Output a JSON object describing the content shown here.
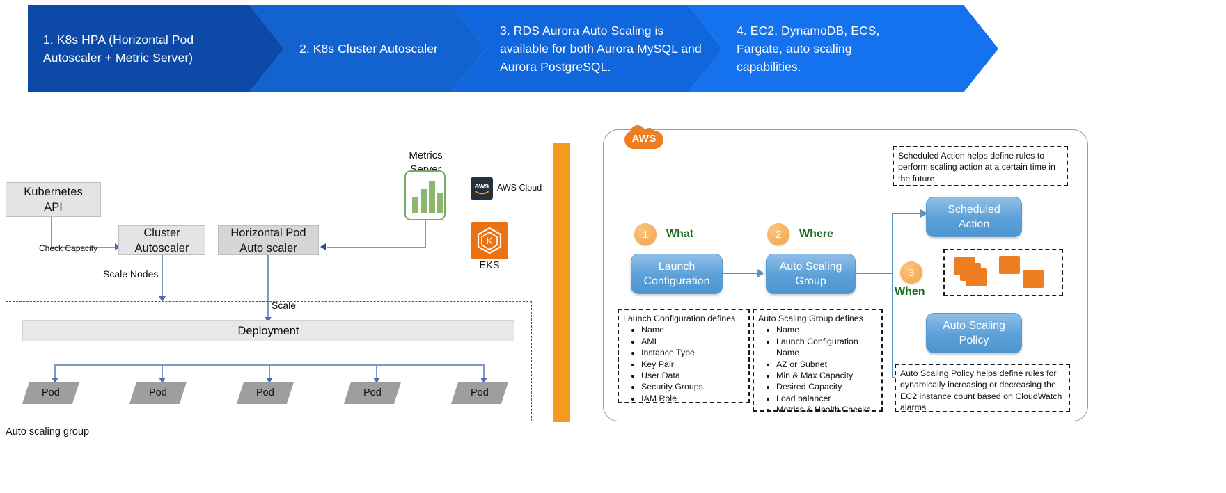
{
  "banner": {
    "steps": [
      {
        "label": "1. K8s HPA (Horizontal Pod Autoscaler + Metric Server)",
        "color": "#0d4aa7"
      },
      {
        "label": "2. K8s Cluster Autoscaler",
        "color": "#1262d0"
      },
      {
        "label": "3. RDS Aurora Auto Scaling is available for both Aurora MySQL and Aurora PostgreSQL.",
        "color": "#1066dd"
      },
      {
        "label": "4. EC2, DynamoDB, ECS, Fargate, auto scaling capabilities.",
        "color": "#1572ee"
      }
    ]
  },
  "k8s_diagram": {
    "kubernetes_api": "Kubernetes\nAPI",
    "kubernetes_api_line1": "Kubernetes",
    "kubernetes_api_line2": "API",
    "cluster_autoscaler_line1": "Cluster",
    "cluster_autoscaler_line2": "Autoscaler",
    "hpa_line1": "Horizontal Pod",
    "hpa_line2": "Auto scaler",
    "metrics_server_line1": "Metrics",
    "metrics_server_line2": "Server",
    "aws_cloud_icon_text": "aws",
    "aws_cloud_label": "AWS Cloud",
    "eks_label": "EKS",
    "edge_check_capacity": "Check Capacity",
    "edge_scale_nodes": "Scale Nodes",
    "edge_scale": "Scale",
    "deployment_label": "Deployment",
    "pods": [
      "Pod",
      "Pod",
      "Pod",
      "Pod",
      "Pod"
    ],
    "asg_caption": "Auto scaling group"
  },
  "aws_diagram": {
    "cloud_badge": "AWS",
    "steps": [
      {
        "num": "1",
        "word": "What"
      },
      {
        "num": "2",
        "word": "Where"
      },
      {
        "num": "3",
        "word": "When"
      }
    ],
    "launch_configuration_line1": "Launch",
    "launch_configuration_line2": "Configuration",
    "auto_scaling_group_line1": "Auto Scaling",
    "auto_scaling_group_line2": "Group",
    "scheduled_action_line1": "Scheduled",
    "scheduled_action_line2": "Action",
    "auto_scaling_policy_line1": "Auto Scaling",
    "auto_scaling_policy_line2": "Policy",
    "scheduled_action_note": "Scheduled Action helps define rules to perform scaling action at a certain time in the future",
    "auto_scaling_policy_note": "Auto Scaling Policy helps define rules for dynamically increasing or decreasing the EC2 instance count based on CloudWatch alarms",
    "launch_config_note_title": "Launch Configuration defines",
    "launch_config_note_items": [
      "Name",
      "AMI",
      "Instance Type",
      "Key Pair",
      "User Data",
      "Security Groups",
      "IAM Role"
    ],
    "asg_note_title": "Auto Scaling Group defines",
    "asg_note_items": [
      "Name",
      "Launch Configuration Name",
      "AZ or Subnet",
      "Min & Max Capacity",
      "Desired Capacity",
      "Load balancer",
      "Metrics & Health Checks"
    ]
  },
  "colors": {
    "aws_orange": "#ef7d22",
    "divider_orange": "#f59b1c",
    "blue_box": "#5ba0d8",
    "green_step": "#1a6b1a",
    "banner_dark_blue": "#0d4aa7",
    "metrics_green": "#8cb76f",
    "pod_gray": "#9e9e9e"
  }
}
